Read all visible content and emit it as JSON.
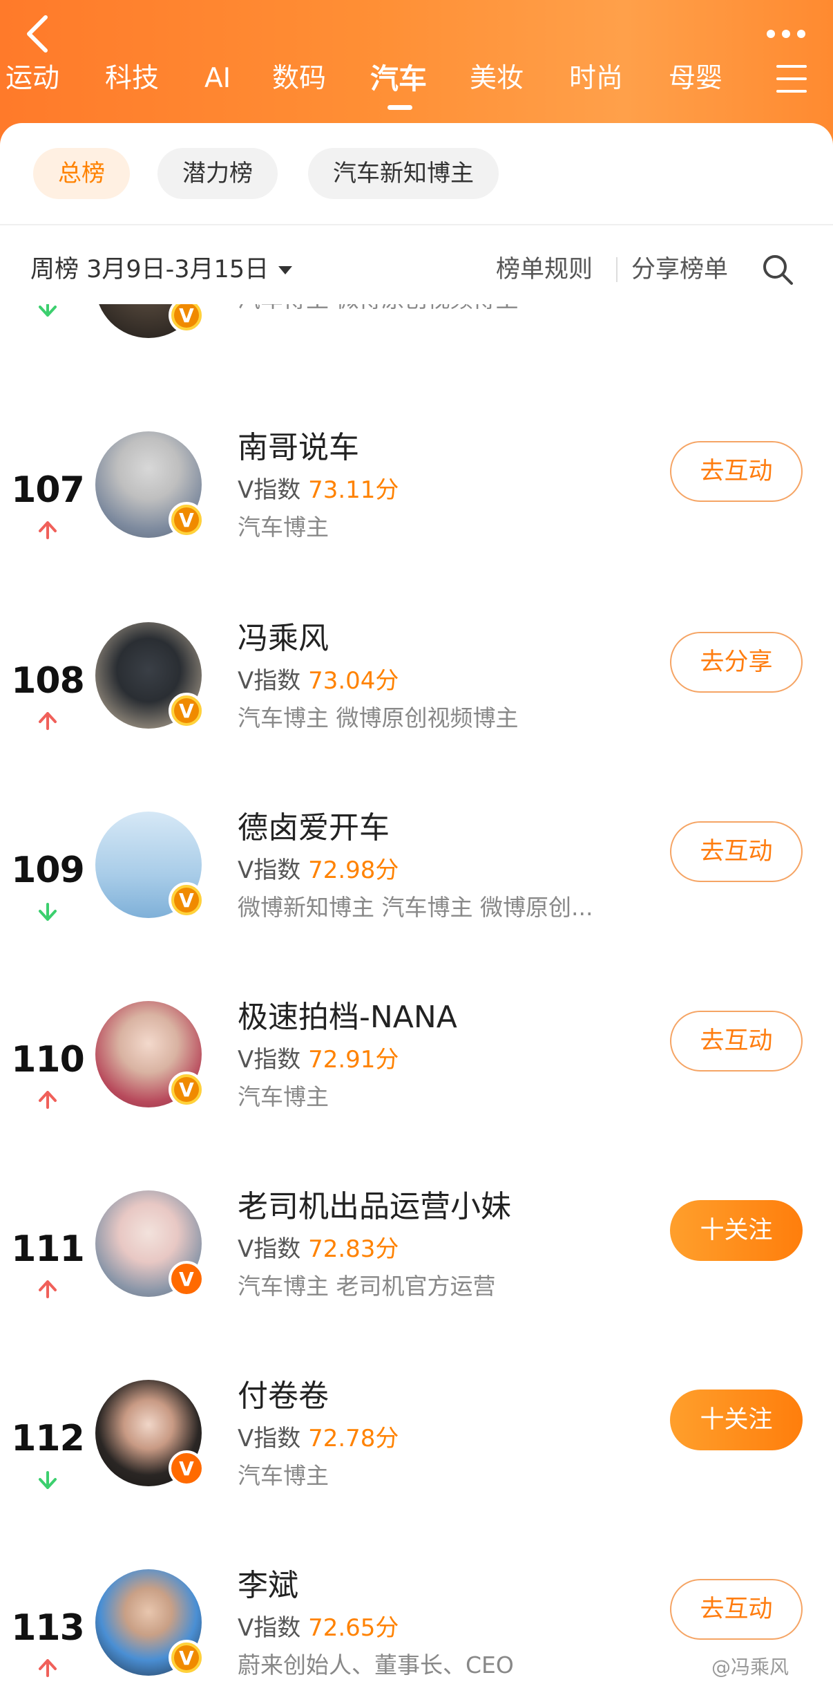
{
  "header": {
    "tabs": [
      "运动",
      "科技",
      "AI",
      "数码",
      "汽车",
      "美妆",
      "时尚",
      "母婴"
    ],
    "active_tab": "汽车"
  },
  "filters": [
    "总榜",
    "潜力榜",
    "汽车新知博主"
  ],
  "toolbar": {
    "period": "周榜 3月9日-3月15日",
    "rules": "榜单规则",
    "share": "分享榜单"
  },
  "partial_row": {
    "tags": "汽车博主 微博原创视频博主",
    "trend": "down"
  },
  "list": [
    {
      "rank": "107",
      "trend": "up",
      "name": "南哥说车",
      "score_label": "V指数",
      "score": "73.11分",
      "tags": "汽车博主",
      "button": "去互动",
      "button_style": "outline",
      "badge": "gold"
    },
    {
      "rank": "108",
      "trend": "up",
      "name": "冯乘风",
      "score_label": "V指数",
      "score": "73.04分",
      "tags": "汽车博主 微博原创视频博主",
      "button": "去分享",
      "button_style": "outline",
      "badge": "gold"
    },
    {
      "rank": "109",
      "trend": "down",
      "name": "德卤爱开车",
      "score_label": "V指数",
      "score": "72.98分",
      "tags": "微博新知博主 汽车博主 微博原创...",
      "button": "去互动",
      "button_style": "outline",
      "badge": "gold"
    },
    {
      "rank": "110",
      "trend": "up",
      "name": "极速拍档-NANA",
      "score_label": "V指数",
      "score": "72.91分",
      "tags": "汽车博主",
      "button": "去互动",
      "button_style": "outline",
      "badge": "gold"
    },
    {
      "rank": "111",
      "trend": "up",
      "name": "老司机出品运营小妹",
      "score_label": "V指数",
      "score": "72.83分",
      "tags": "汽车博主 老司机官方运营",
      "button": "十关注",
      "button_style": "filled",
      "badge": "orange"
    },
    {
      "rank": "112",
      "trend": "down",
      "name": "付卷卷",
      "score_label": "V指数",
      "score": "72.78分",
      "tags": "汽车博主",
      "button": "十关注",
      "button_style": "filled",
      "badge": "orange"
    },
    {
      "rank": "113",
      "trend": "up",
      "name": "李斌",
      "score_label": "V指数",
      "score": "72.65分",
      "tags": "蔚来创始人、董事长、CEO",
      "button": "去互动",
      "button_style": "outline",
      "badge": "gold"
    }
  ],
  "watermark": "@冯乘风",
  "colors": {
    "accent": "#ff8200",
    "trend_up": "#f0605a",
    "trend_down": "#3ccf6e"
  }
}
